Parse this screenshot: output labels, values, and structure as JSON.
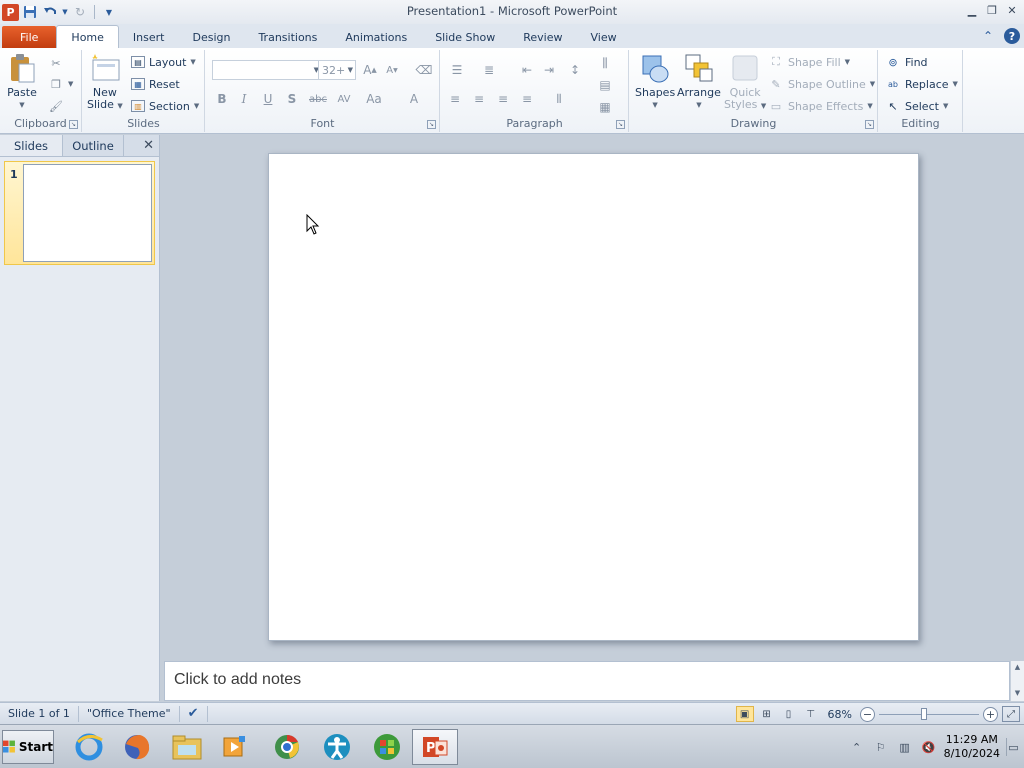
{
  "window": {
    "title": "Presentation1 - Microsoft PowerPoint",
    "app_icon_letter": "P"
  },
  "tabs": [
    {
      "label": "File"
    },
    {
      "label": "Home"
    },
    {
      "label": "Insert"
    },
    {
      "label": "Design"
    },
    {
      "label": "Transitions"
    },
    {
      "label": "Animations"
    },
    {
      "label": "Slide Show"
    },
    {
      "label": "Review"
    },
    {
      "label": "View"
    }
  ],
  "ribbon": {
    "clipboard": {
      "label": "Clipboard",
      "paste": "Paste"
    },
    "slides": {
      "label": "Slides",
      "new_slide_line1": "New",
      "new_slide_line2": "Slide",
      "layout": "Layout",
      "reset": "Reset",
      "section": "Section"
    },
    "font": {
      "label": "Font",
      "size": "32+",
      "bold": "B",
      "italic": "I",
      "underline": "U",
      "shadow": "S",
      "strike": "abc",
      "spacing": "AV",
      "case": "Aa",
      "color": "A"
    },
    "paragraph": {
      "label": "Paragraph"
    },
    "drawing": {
      "label": "Drawing",
      "shapes": "Shapes",
      "arrange": "Arrange",
      "quick_styles_line1": "Quick",
      "quick_styles_line2": "Styles",
      "shape_fill": "Shape Fill",
      "shape_outline": "Shape Outline",
      "shape_effects": "Shape Effects"
    },
    "editing": {
      "label": "Editing",
      "find": "Find",
      "replace": "Replace",
      "select": "Select"
    }
  },
  "left_pane": {
    "tabs": [
      {
        "label": "Slides"
      },
      {
        "label": "Outline"
      }
    ],
    "thumbnail_number": "1"
  },
  "notes": {
    "placeholder": "Click to add notes"
  },
  "status_bar": {
    "slide_info": "Slide 1 of 1",
    "theme": "\"Office Theme\"",
    "zoom": "68%",
    "zoom_level": 0.45
  },
  "taskbar": {
    "start_label": "Start",
    "time": "11:29 AM",
    "date": "8/10/2024"
  }
}
